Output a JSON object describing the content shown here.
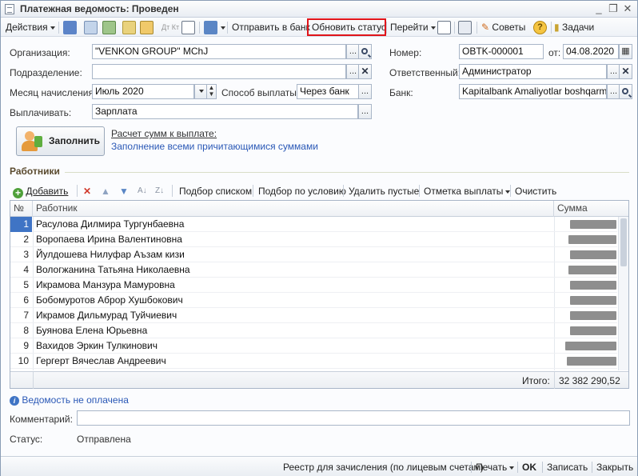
{
  "window": {
    "title": "Платежная ведомость: Проведен"
  },
  "toolbar": {
    "actions_label": "Действия",
    "send_to_bank_label": "Отправить в банк",
    "update_status_label": "Обновить статус",
    "goto_label": "Перейти",
    "tips_label": "Советы",
    "tasks_label": "Задачи",
    "dt_kt_label": "Дт Кт"
  },
  "form": {
    "org_label": "Организация:",
    "org_value": "\"VENKON GROUP\" MChJ",
    "subdivision_label": "Подразделение:",
    "subdivision_value": "",
    "month_label": "Месяц начисления:",
    "month_value": "Июль 2020",
    "method_label": "Способ выплаты:",
    "method_value": "Через банк",
    "pay_label": "Выплачивать:",
    "pay_value": "Зарплата",
    "number_label": "Номер:",
    "number_value": "OBTK-000001",
    "date_label": "от:",
    "date_value": "04.08.2020",
    "responsible_label": "Ответственный:",
    "responsible_value": "Администратор",
    "bank_label": "Банк:",
    "bank_value": "Kapitalbank Amaliyotlar boshqarmasi",
    "fill_button_label": "Заполнить",
    "calc_link": "Расчет сумм к выплате:",
    "fill_mode_link": "Заполнение всеми причитающимися суммами"
  },
  "workers": {
    "section_title": "Работники",
    "add_label": "Добавить",
    "pick_list_label": "Подбор списком",
    "pick_condition_label": "Подбор по условию",
    "delete_empty_label": "Удалить пустые",
    "payment_mark_label": "Отметка выплаты",
    "clear_label": "Очистить",
    "col_num": "№",
    "col_worker": "Работник",
    "col_sum": "Сумма",
    "rows": [
      {
        "n": "1",
        "name": "Расулова Дилмира Тургунбаевна"
      },
      {
        "n": "2",
        "name": "Воропаева Ирина Валентиновна"
      },
      {
        "n": "3",
        "name": "Йулдошева Нилуфар Аъзам кизи"
      },
      {
        "n": "4",
        "name": "Вологжанина Татьяна Николаевна"
      },
      {
        "n": "5",
        "name": "Икрамова Манзура Мамуровна"
      },
      {
        "n": "6",
        "name": "Бобомуротов Аброр Хушбокович"
      },
      {
        "n": "7",
        "name": "Икрамов Дильмурад Туйчиевич"
      },
      {
        "n": "8",
        "name": "Буянова Елена Юрьевна"
      },
      {
        "n": "9",
        "name": "Вахидов Эркин Тулкинович"
      },
      {
        "n": "10",
        "name": "Гергерт Вячеслав Андреевич"
      }
    ],
    "total_label": "Итого:",
    "total_value": "32 382 290,52"
  },
  "info_link": "Ведомость не оплачена",
  "comment_label": "Комментарий:",
  "comment_value": "",
  "status_label": "Статус:",
  "status_value": "Отправлена",
  "bottom": {
    "registry_label": "Реестр для зачисления (по лицевым счетам)",
    "print_label": "Печать",
    "ok_label": "OK",
    "save_label": "Записать",
    "close_label": "Закрыть"
  },
  "colors": {
    "highlight": "#e0141a",
    "link": "#2a58b6",
    "selection": "#3f74c5"
  }
}
